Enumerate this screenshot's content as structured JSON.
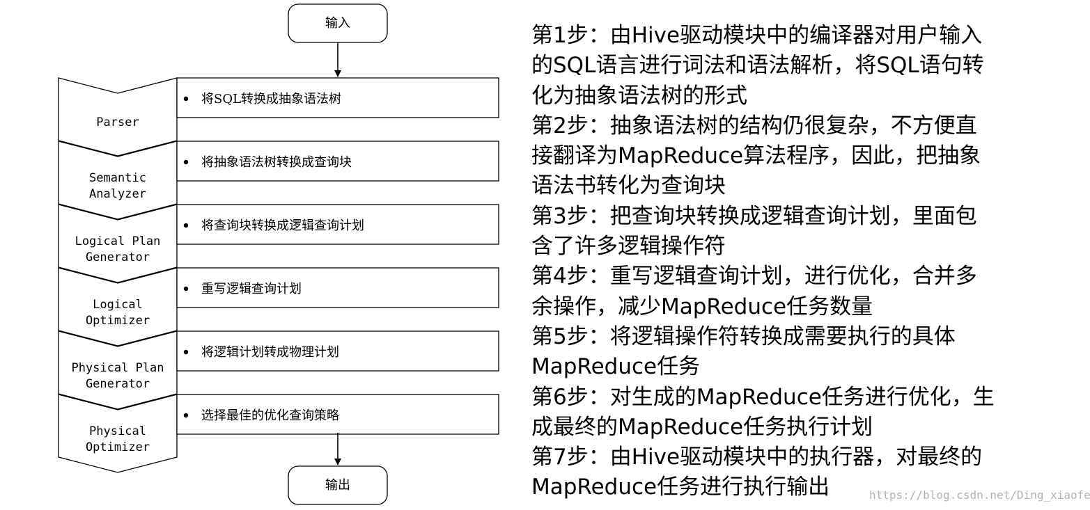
{
  "flow": {
    "input_label": "输入",
    "output_label": "输出",
    "stages": [
      {
        "name_lines": [
          "Parser"
        ],
        "description": "将SQL转换成抽象语法树"
      },
      {
        "name_lines": [
          "Semantic",
          "Analyzer"
        ],
        "description": "将抽象语法树转换成查询块"
      },
      {
        "name_lines": [
          "Logical Plan",
          "Generator"
        ],
        "description": "将查询块转换成逻辑查询计划"
      },
      {
        "name_lines": [
          "Logical",
          "Optimizer"
        ],
        "description": "重写逻辑查询计划"
      },
      {
        "name_lines": [
          "Physical Plan",
          "Generator"
        ],
        "description": "将逻辑计划转成物理计划"
      },
      {
        "name_lines": [
          "Physical",
          "Optimizer"
        ],
        "description": "选择最佳的优化查询策略"
      }
    ]
  },
  "steps_lines": [
    "第1步：由Hive驱动模块中的编译器对用户输入",
    "的SQL语言进行词法和语法解析，将SQL语句转",
    "化为抽象语法树的形式",
    "第2步：抽象语法树的结构仍很复杂，不方便直",
    "接翻译为MapReduce算法程序，因此，把抽象",
    "语法书转化为查询块",
    "第3步：把查询块转换成逻辑查询计划，里面包",
    "含了许多逻辑操作符",
    "第4步：重写逻辑查询计划，进行优化，合并多",
    "余操作，减少MapReduce任务数量",
    "第5步：将逻辑操作符转换成需要执行的具体",
    "MapReduce任务",
    "第6步：对生成的MapReduce任务进行优化，生",
    "成最终的MapReduce任务执行计划",
    "第7步：由Hive驱动模块中的执行器，对最终的",
    "MapReduce任务进行执行输出"
  ],
  "watermark": "https://blog.csdn.net/Ding_xiaofei"
}
